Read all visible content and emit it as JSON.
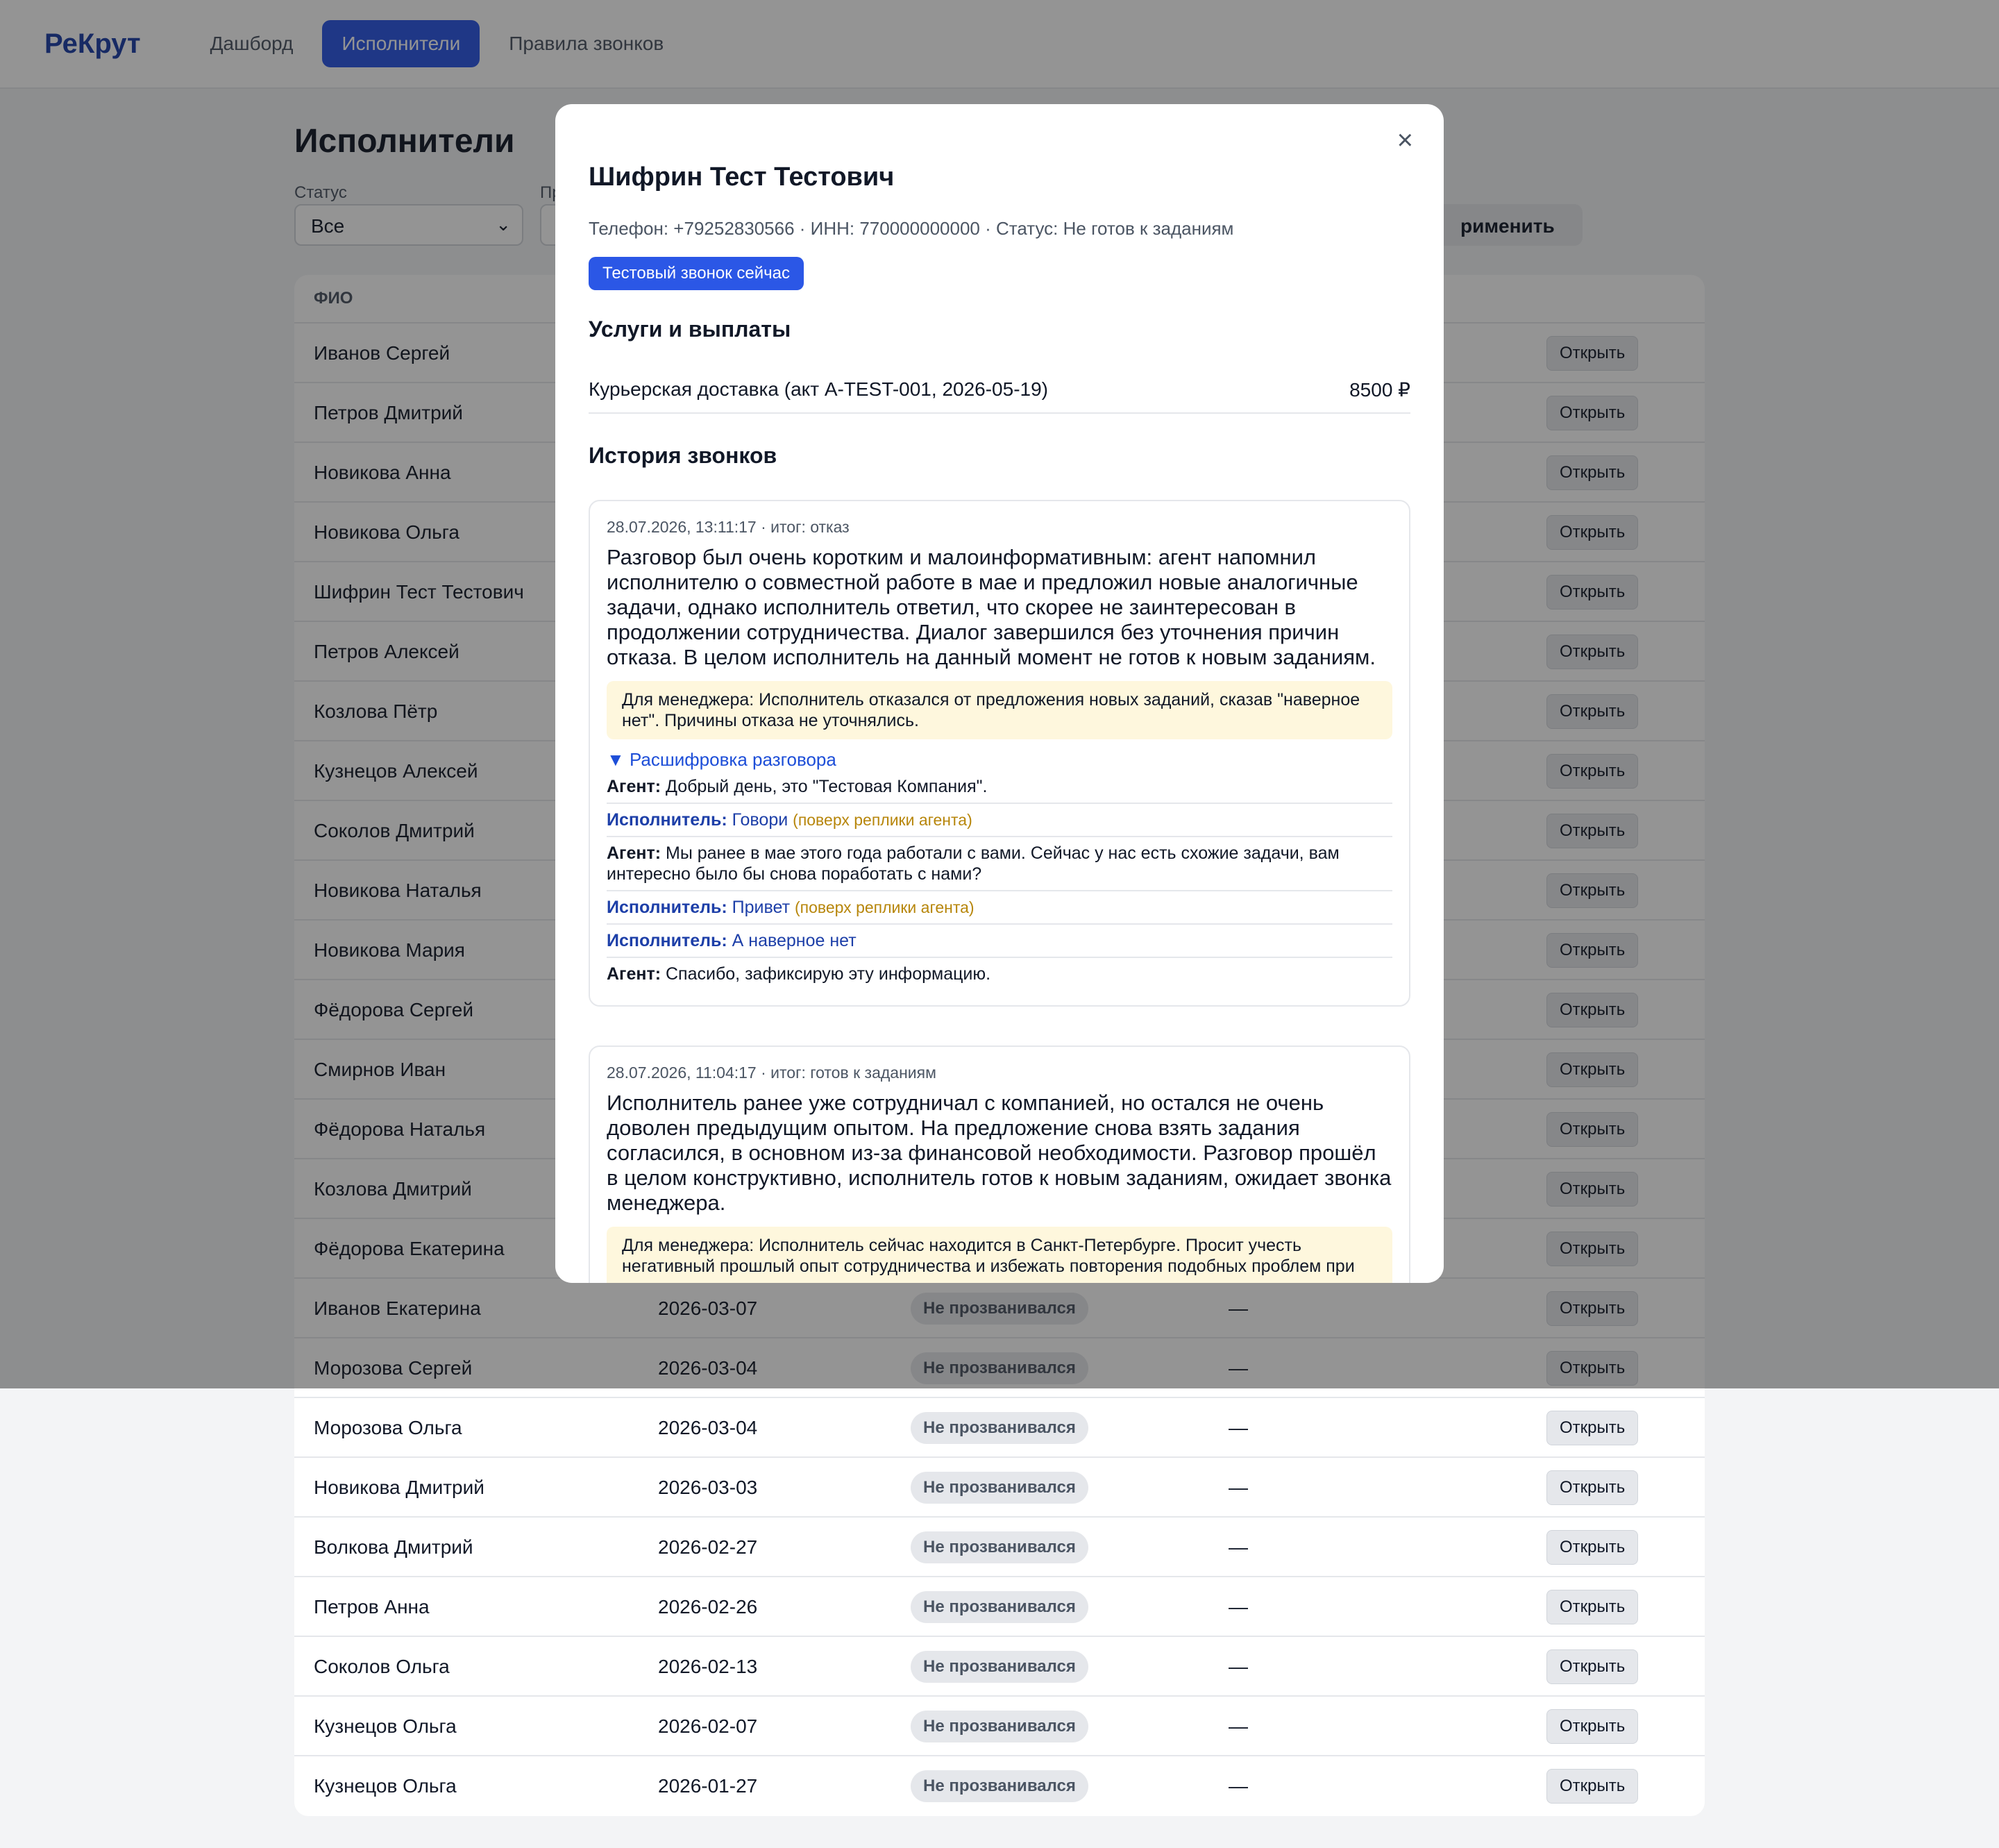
{
  "app": {
    "logo": "РеКрут",
    "nav": [
      {
        "label": "Дашборд",
        "active": false
      },
      {
        "label": "Исполнители",
        "active": true
      },
      {
        "label": "Правила звонков",
        "active": false
      }
    ]
  },
  "page": {
    "title": "Исполнители",
    "filters": {
      "status_label": "Статус",
      "status_value": "Все",
      "second_label_partial": "Пр",
      "apply_label": "рименить"
    },
    "table": {
      "headers": [
        "ФИО"
      ],
      "rows": [
        {
          "name": "Иванов Сергей",
          "date": "",
          "status": "",
          "dash": "",
          "open": "Открыть"
        },
        {
          "name": "Петров Дмитрий",
          "date": "",
          "status": "",
          "dash": "",
          "open": "Открыть"
        },
        {
          "name": "Новикова Анна",
          "date": "",
          "status": "",
          "dash": "",
          "open": "Открыть"
        },
        {
          "name": "Новикова Ольга",
          "date": "",
          "status": "",
          "dash": "",
          "open": "Открыть"
        },
        {
          "name": "Шифрин Тест Тестович",
          "date": "",
          "status": "",
          "dash": "",
          "open": "Открыть"
        },
        {
          "name": "Петров Алексей",
          "date": "",
          "status": "",
          "dash": "",
          "open": "Открыть"
        },
        {
          "name": "Козлова Пётр",
          "date": "",
          "status": "",
          "dash": "",
          "open": "Открыть"
        },
        {
          "name": "Кузнецов Алексей",
          "date": "",
          "status": "",
          "dash": "",
          "open": "Открыть"
        },
        {
          "name": "Соколов Дмитрий",
          "date": "",
          "status": "",
          "dash": "",
          "open": "Открыть"
        },
        {
          "name": "Новикова Наталья",
          "date": "",
          "status": "",
          "dash": "",
          "open": "Открыть"
        },
        {
          "name": "Новикова Мария",
          "date": "",
          "status": "",
          "dash": "",
          "open": "Открыть"
        },
        {
          "name": "Фёдорова Сергей",
          "date": "",
          "status": "",
          "dash": "",
          "open": "Открыть"
        },
        {
          "name": "Смирнов Иван",
          "date": "",
          "status": "",
          "dash": "",
          "open": "Открыть"
        },
        {
          "name": "Фёдорова Наталья",
          "date": "",
          "status": "",
          "dash": "",
          "open": "Открыть"
        },
        {
          "name": "Козлова Дмитрий",
          "date": "",
          "status": "",
          "dash": "",
          "open": "Открыть"
        },
        {
          "name": "Фёдорова Екатерина",
          "date": "",
          "status": "",
          "dash": "",
          "open": "Открыть"
        },
        {
          "name": "Иванов Екатерина",
          "date": "2026-03-07",
          "status": "Не прозванивался",
          "dash": "—",
          "open": "Открыть"
        },
        {
          "name": "Морозова Сергей",
          "date": "2026-03-04",
          "status": "Не прозванивался",
          "dash": "—",
          "open": "Открыть"
        },
        {
          "name": "Морозова Ольга",
          "date": "2026-03-04",
          "status": "Не прозванивался",
          "dash": "—",
          "open": "Открыть"
        },
        {
          "name": "Новикова Дмитрий",
          "date": "2026-03-03",
          "status": "Не прозванивался",
          "dash": "—",
          "open": "Открыть"
        },
        {
          "name": "Волкова Дмитрий",
          "date": "2026-02-27",
          "status": "Не прозванивался",
          "dash": "—",
          "open": "Открыть"
        },
        {
          "name": "Петров Анна",
          "date": "2026-02-26",
          "status": "Не прозванивался",
          "dash": "—",
          "open": "Открыть"
        },
        {
          "name": "Соколов Ольга",
          "date": "2026-02-13",
          "status": "Не прозванивался",
          "dash": "—",
          "open": "Открыть"
        },
        {
          "name": "Кузнецов Ольга",
          "date": "2026-02-07",
          "status": "Не прозванивался",
          "dash": "—",
          "open": "Открыть"
        },
        {
          "name": "Кузнецов Ольга",
          "date": "2026-01-27",
          "status": "Не прозванивался",
          "dash": "—",
          "open": "Открыть"
        }
      ]
    }
  },
  "modal": {
    "close_icon": "×",
    "title": "Шифрин Тест Тестович",
    "meta": "Телефон: +79252830566 · ИНН: 770000000000 · Статус: Не готов к заданиям",
    "test_call_button": "Тестовый звонок сейчас",
    "services_heading": "Услуги и выплаты",
    "service": {
      "label": "Курьерская доставка (акт A-TEST-001, 2026-05-19)",
      "amount": "8500 ₽"
    },
    "history_heading": "История звонков",
    "calls": [
      {
        "head": "28.07.2026, 13:11:17 · итог: отказ",
        "summary": "Разговор был очень коротким и малоинформативным: агент напомнил исполнителю о совместной работе в мае и предложил новые аналогичные задачи, однако исполнитель ответил, что скорее не заинтересован в продолжении сотрудничества. Диалог завершился без уточнения причин отказа. В целом исполнитель на данный момент не готов к новым заданиям.",
        "manager_note": "Для менеджера: Исполнитель отказался от предложения новых заданий, сказав \"наверное нет\". Причины отказа не уточнялись.",
        "transcript_toggle": "▼ Расшифровка разговора",
        "transcript": [
          {
            "speaker": "Агент:",
            "role": "agent",
            "text": "Добрый день, это \"Тестовая Компания\".",
            "note": ""
          },
          {
            "speaker": "Исполнитель:",
            "role": "exec",
            "text": "Говори",
            "note": "(поверх реплики агента)"
          },
          {
            "speaker": "Агент:",
            "role": "agent",
            "text": "Мы ранее в мае этого года работали с вами. Сейчас у нас есть схожие задачи, вам интересно было бы снова поработать с нами?",
            "note": ""
          },
          {
            "speaker": "Исполнитель:",
            "role": "exec",
            "text": "Привет",
            "note": "(поверх реплики агента)"
          },
          {
            "speaker": "Исполнитель:",
            "role": "exec",
            "text": "А наверное нет",
            "note": ""
          },
          {
            "speaker": "Агент:",
            "role": "agent",
            "text": "Спасибо, зафиксирую эту информацию.",
            "note": ""
          }
        ]
      },
      {
        "head": "28.07.2026, 11:04:17 · итог: готов к заданиям",
        "summary": "Исполнитель ранее уже сотрудничал с компанией, но остался не очень доволен предыдущим опытом. На предложение снова взять задания согласился, в основном из-за финансовой необходимости. Разговор прошёл в целом конструктивно, исполнитель готов к новым заданиям, ожидает звонка менеджера.",
        "manager_note": "Для менеджера: Исполнитель сейчас находится в Санкт-Петербурге. Просит учесть негативный прошлый опыт сотрудничества и избежать повторения подобных проблем при новом сотрудничестве."
      }
    ]
  }
}
